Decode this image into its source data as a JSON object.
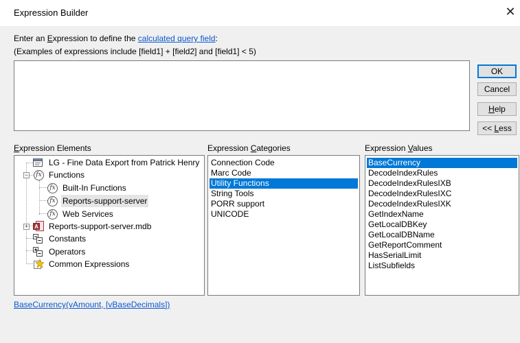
{
  "window": {
    "title": "Expression Builder"
  },
  "prompt": {
    "line1_prefix": "Enter an ",
    "line1_underlined": "E",
    "line1_mid": "xpression to define the ",
    "line1_link": "calculated query field",
    "line1_suffix": ":",
    "line2": "(Examples of expressions include [field1] + [field2] and [field1] < 5)"
  },
  "expression": {
    "value": ""
  },
  "buttons": {
    "ok": "OK",
    "cancel": "Cancel",
    "help_u": "H",
    "help_rest": "elp",
    "less_prefix": "<< ",
    "less_u": "L",
    "less_rest": "ess"
  },
  "sections": {
    "elements_u": "E",
    "elements_rest": "xpression Elements",
    "categories_prefix": "Expression ",
    "categories_u": "C",
    "categories_rest": "ategories",
    "values_prefix": "Expression ",
    "values_u": "V",
    "values_rest": "alues"
  },
  "tree": [
    {
      "label": "LG - Fine Data Export from Patrick Henry",
      "icon": "form-icon"
    },
    {
      "label": "Functions",
      "icon": "function-icon",
      "expanded": true
    },
    {
      "label": "Built-In Functions",
      "icon": "function-icon"
    },
    {
      "label": "Reports-support-server",
      "icon": "function-icon",
      "selected": true
    },
    {
      "label": "Web Services",
      "icon": "function-icon"
    },
    {
      "label": "Reports-support-server.mdb",
      "icon": "access-db-icon"
    },
    {
      "label": "Constants",
      "icon": "constants-icon"
    },
    {
      "label": "Operators",
      "icon": "operators-icon"
    },
    {
      "label": "Common Expressions",
      "icon": "common-expressions-icon"
    }
  ],
  "categories": [
    "Connection Code",
    "Marc Code",
    "Utility Functions",
    "String Tools",
    "PORR support",
    "UNICODE"
  ],
  "selected_category": "Utility Functions",
  "values": [
    "BaseCurrency",
    "DecodeIndexRules",
    "DecodeIndexRulesIXB",
    "DecodeIndexRulesIXC",
    "DecodeIndexRulesIXK",
    "GetIndexName",
    "GetLocalDBKey",
    "GetLocalDBName",
    "GetReportComment",
    "HasSerialLimit",
    "ListSubfields"
  ],
  "selected_value": "BaseCurrency",
  "syntax": "BaseCurrency(vAmount, [vBaseDecimals])",
  "colors": {
    "selection": "#0078d7",
    "link": "#0b57d0"
  }
}
